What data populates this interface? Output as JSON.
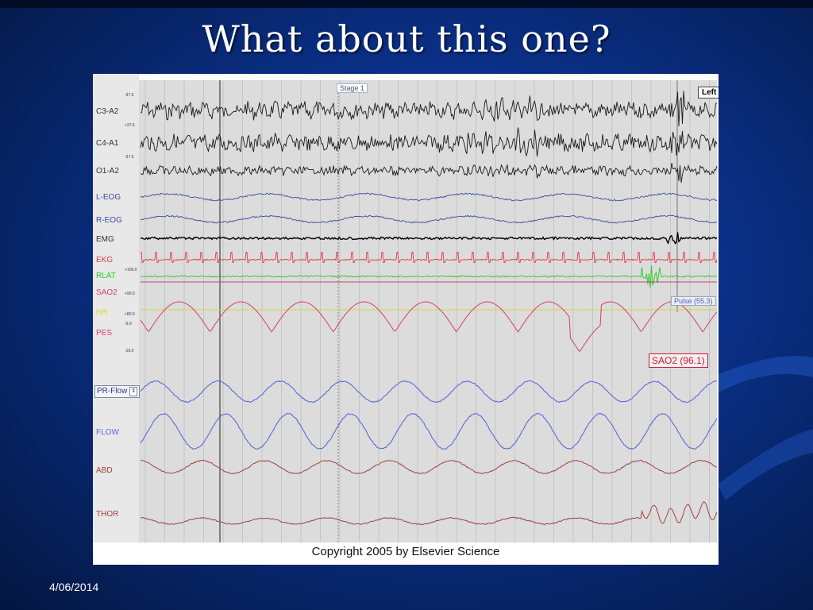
{
  "slide": {
    "title": "What about this one?",
    "date": "4/06/2014"
  },
  "figure": {
    "copyright": "Copyright 2005 by Elsevier Science",
    "stage_label": "Stage 1",
    "left_label": "Left",
    "pulse_label": "Pulse (55.3)",
    "sao2_label": "SAO2 (96.1)",
    "selector_label": "PR-Flow",
    "channels": [
      {
        "name": "C3-A2",
        "color": "#1a1a1a"
      },
      {
        "name": "C4-A1",
        "color": "#1a1a1a"
      },
      {
        "name": "O1-A2",
        "color": "#1a1a1a"
      },
      {
        "name": "L-EOG",
        "color": "#3a4aa0"
      },
      {
        "name": "R-EOG",
        "color": "#3a4aa0"
      },
      {
        "name": "EMG",
        "color": "#000000"
      },
      {
        "name": "EKG",
        "color": "#e03c3c"
      },
      {
        "name": "RLAT",
        "color": "#22cc22"
      },
      {
        "name": "SAO2",
        "color": "#d04070"
      },
      {
        "name": "HR",
        "color": "#d8d82a"
      },
      {
        "name": "PES",
        "color": "#d04070"
      },
      {
        "name": "FLOW",
        "color": "#5b6bd8"
      },
      {
        "name": "ABD",
        "color": "#a04040"
      },
      {
        "name": "THOR",
        "color": "#a04040"
      }
    ],
    "scale_marks": [
      "-37.5",
      "+37.5",
      "-37.5",
      "+100.0",
      "+90.0",
      "+80.0",
      "-5.0",
      "-10.0"
    ]
  }
}
